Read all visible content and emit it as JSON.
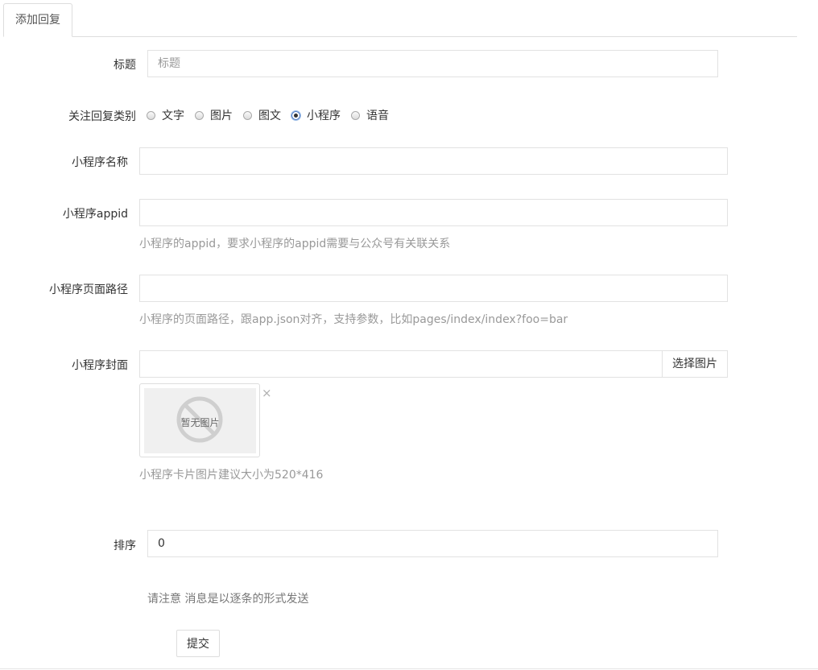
{
  "tabs": [
    {
      "label": "添加回复"
    }
  ],
  "form": {
    "title": {
      "label": "标题",
      "placeholder": "标题",
      "value": ""
    },
    "reply_type": {
      "label": "关注回复类别",
      "options": [
        {
          "label": "文字",
          "checked": false
        },
        {
          "label": "图片",
          "checked": false
        },
        {
          "label": "图文",
          "checked": false
        },
        {
          "label": "小程序",
          "checked": true
        },
        {
          "label": "语音",
          "checked": false
        }
      ]
    },
    "mp_name": {
      "label": "小程序名称",
      "value": ""
    },
    "mp_appid": {
      "label": "小程序appid",
      "value": "",
      "help": "小程序的appid，要求小程序的appid需要与公众号有关联关系"
    },
    "mp_path": {
      "label": "小程序页面路径",
      "value": "",
      "help": "小程序的页面路径，跟app.json对齐，支持参数，比如pages/index/index?foo=bar"
    },
    "mp_cover": {
      "label": "小程序封面",
      "value": "",
      "choose_button": "选择图片",
      "no_image_text": "暂无图片",
      "remove_glyph": "×",
      "help": "小程序卡片图片建议大小为520*416"
    },
    "sort": {
      "label": "排序",
      "value": "0"
    },
    "note": "请注意 消息是以逐条的形式发送",
    "submit_label": "提交"
  },
  "colors": {
    "border": "#e2e2e2",
    "help_text": "#999999",
    "radio_checked": "#4a78c2"
  },
  "icons": {
    "no_image": "no-image-icon",
    "remove": "close-icon"
  }
}
